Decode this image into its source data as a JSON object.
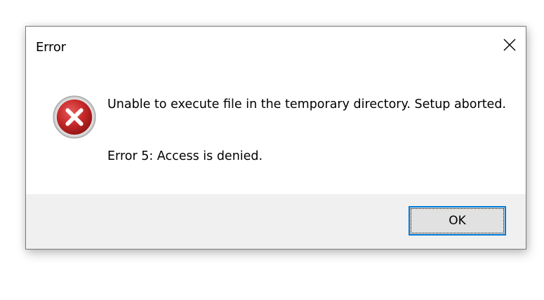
{
  "dialog": {
    "title": "Error",
    "close_icon": "close-icon",
    "icon": "error-icon",
    "message": "Unable to execute file in the temporary directory. Setup aborted.",
    "detail": "Error 5: Access is denied.",
    "ok_label": "OK"
  },
  "colors": {
    "error_red": "#c62828",
    "focus_blue": "#0078d7",
    "footer_bg": "#f0f0f0"
  }
}
